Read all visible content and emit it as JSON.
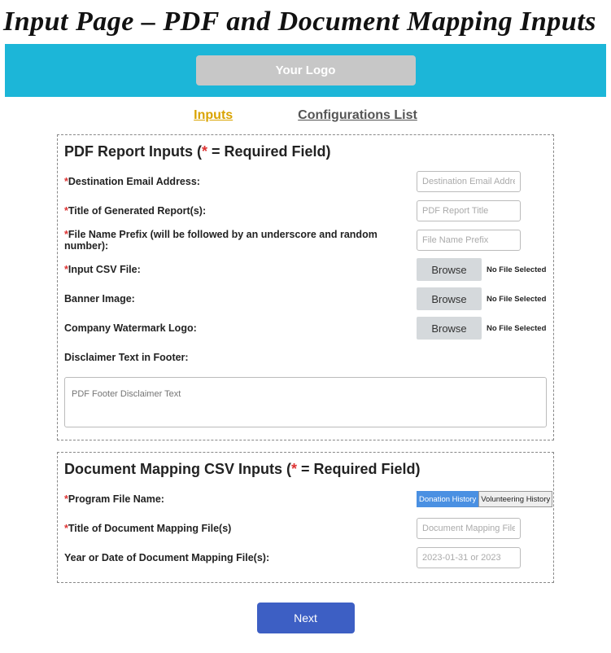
{
  "page_title": "Input Page – PDF and Document Mapping Inputs",
  "logo_label": "Your Logo",
  "tabs": {
    "inputs": "Inputs",
    "config": "Configurations List"
  },
  "pdf": {
    "heading_pre": "PDF Report Inputs (",
    "heading_post": " = Required Field)",
    "dest_label": "Destination Email Address:",
    "dest_ph": "Destination Email Address",
    "title_label": "Title of Generated Report(s):",
    "title_ph": "PDF Report Title",
    "prefix_label": "File Name Prefix (will be followed by an underscore and random number):",
    "prefix_ph": "File Name Prefix",
    "csv_label": "Input CSV File:",
    "banner_label": "Banner Image:",
    "watermark_label": "Company Watermark Logo:",
    "disclaimer_label": "Disclaimer Text in Footer:",
    "disclaimer_ph": "PDF Footer Disclaimer Text",
    "browse": "Browse",
    "nofile": "No File Selected"
  },
  "doc": {
    "heading_pre": "Document Mapping CSV Inputs (",
    "heading_post": " = Required Field)",
    "program_label": "Program File Name:",
    "opt1": "Donation History",
    "opt2": "Volunteering History",
    "title_label": "Title of Document Mapping File(s)",
    "title_ph": "Document Mapping File Title",
    "date_label": "Year or Date of Document Mapping File(s):",
    "date_ph": "2023-01-31 or 2023"
  },
  "star": "*",
  "next": "Next"
}
